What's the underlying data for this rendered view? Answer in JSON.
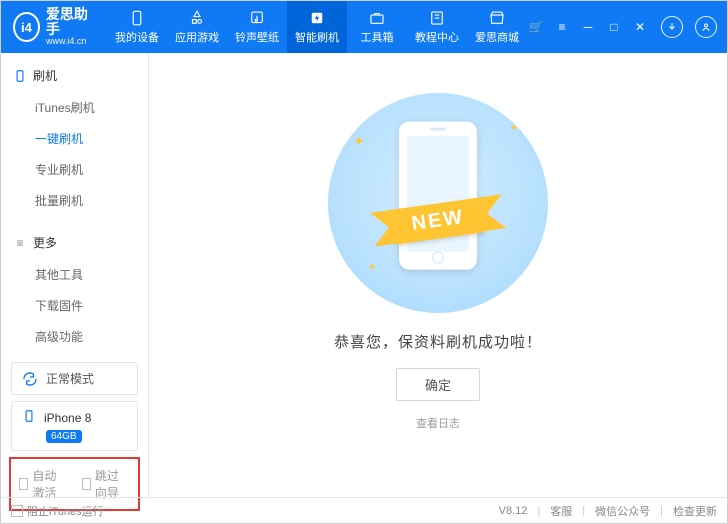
{
  "brand": {
    "logo": "i4",
    "title": "爱思助手",
    "sub": "www.i4.cn"
  },
  "tabs": [
    {
      "label": "我的设备",
      "icon": "device"
    },
    {
      "label": "应用游戏",
      "icon": "apps"
    },
    {
      "label": "铃声壁纸",
      "icon": "music"
    },
    {
      "label": "智能刷机",
      "icon": "flash",
      "active": true
    },
    {
      "label": "工具箱",
      "icon": "toolbox"
    },
    {
      "label": "教程中心",
      "icon": "book"
    },
    {
      "label": "爱思商城",
      "icon": "shop"
    }
  ],
  "sidebar": {
    "group1": {
      "title": "刷机",
      "items": [
        "iTunes刷机",
        "一键刷机",
        "专业刷机",
        "批量刷机"
      ],
      "activeIndex": 1
    },
    "group2": {
      "title": "更多",
      "items": [
        "其他工具",
        "下载固件",
        "高级功能"
      ]
    },
    "mode": "正常模式",
    "device": {
      "name": "iPhone 8",
      "storage": "64GB"
    },
    "options": {
      "auto": "自动激活",
      "skip": "跳过向导"
    }
  },
  "main": {
    "ribbon": "NEW",
    "message": "恭喜您，保资料刷机成功啦！",
    "ok": "确定",
    "log": "查看日志"
  },
  "footer": {
    "block": "阻止iTunes运行",
    "version": "V8.12",
    "service": "客服",
    "wechat": "微信公众号",
    "update": "检查更新"
  }
}
